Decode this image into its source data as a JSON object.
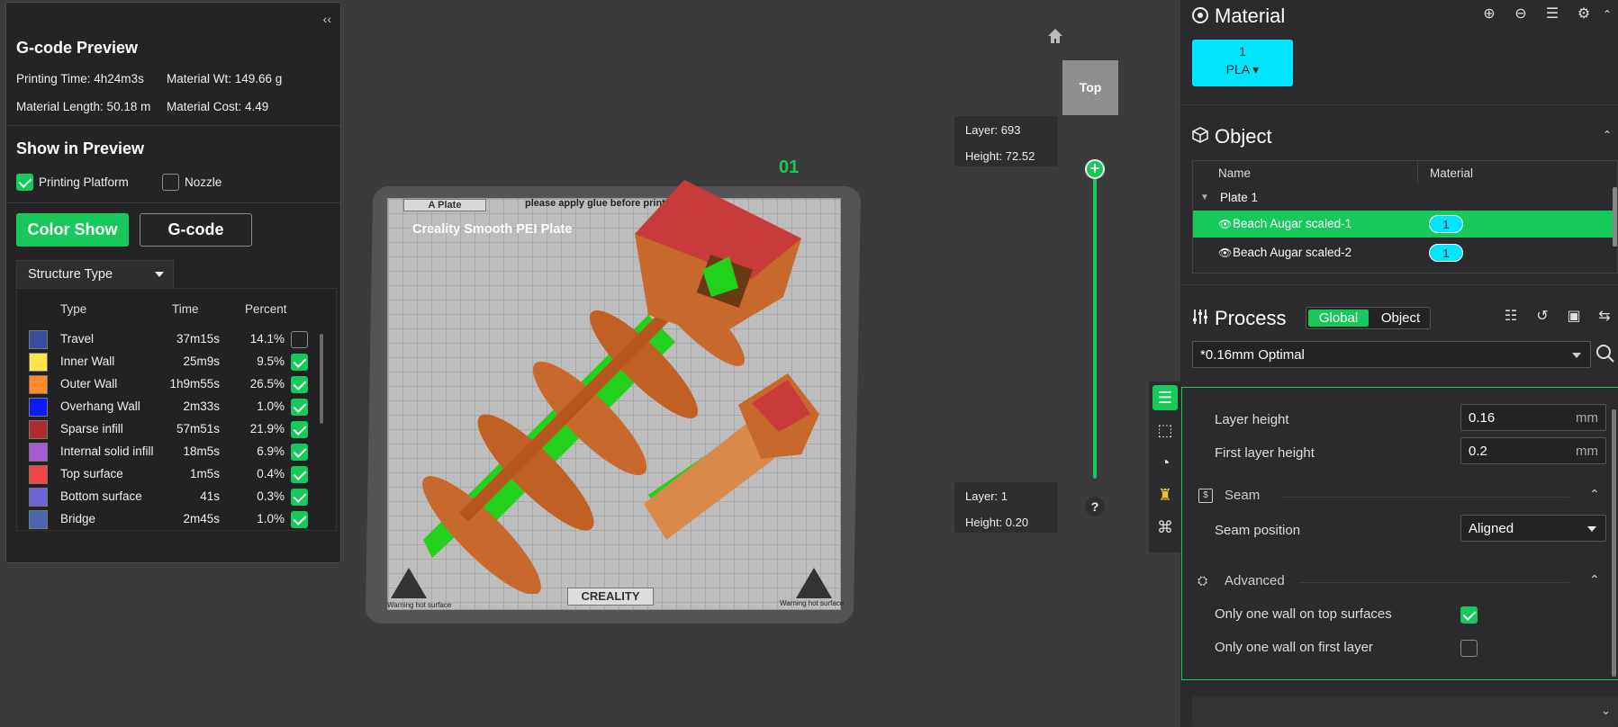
{
  "gcode_panel": {
    "collapse_icon": "double-chevron-left",
    "title": "G-code Preview",
    "printing_time": "Printing Time: 4h24m3s",
    "material_wt": "Material Wt: 149.66 g",
    "material_length": "Material Length: 50.18 m",
    "material_cost": "Material Cost: 4.49",
    "show_in_preview": "Show in Preview",
    "printing_platform": "Printing Platform",
    "nozzle": "Nozzle",
    "color_show": "Color Show",
    "gcode": "G-code",
    "structure_type": "Structure Type",
    "headers": {
      "type": "Type",
      "time": "Time",
      "percent": "Percent"
    },
    "rows": [
      {
        "name": "Travel",
        "time": "37m15s",
        "percent": "14.1%",
        "color": "#3a4f9c",
        "checked": false
      },
      {
        "name": "Inner Wall",
        "time": "25m9s",
        "percent": "9.5%",
        "color": "#ffe24d",
        "checked": true
      },
      {
        "name": "Outer Wall",
        "time": "1h9m55s",
        "percent": "26.5%",
        "color": "#ff8a2b",
        "checked": true
      },
      {
        "name": "Overhang Wall",
        "time": "2m33s",
        "percent": "1.0%",
        "color": "#0a1aff",
        "checked": true
      },
      {
        "name": "Sparse infill",
        "time": "57m51s",
        "percent": "21.9%",
        "color": "#b02b2b",
        "checked": true
      },
      {
        "name": "Internal solid infill",
        "time": "18m5s",
        "percent": "6.9%",
        "color": "#a55bd6",
        "checked": true
      },
      {
        "name": "Top surface",
        "time": "1m5s",
        "percent": "0.4%",
        "color": "#f04848",
        "checked": true
      },
      {
        "name": "Bottom surface",
        "time": "41s",
        "percent": "0.3%",
        "color": "#6b63d6",
        "checked": true
      },
      {
        "name": "Bridge",
        "time": "2m45s",
        "percent": "1.0%",
        "color": "#4a66b0",
        "checked": true
      }
    ]
  },
  "viewport": {
    "plate_tab": "A Plate",
    "plate_note": "please apply glue before printing",
    "plate_name": "Creality Smooth PEI Plate",
    "plate_number": "01",
    "plate_logo": "CREALITY",
    "warning_text": "Warning hot surface",
    "view_cube": "Top",
    "layer_top": {
      "layer": "Layer: 693",
      "height": "Height: 72.52"
    },
    "layer_bottom": {
      "layer": "Layer: 1",
      "height": "Height: 0.20"
    },
    "help": "?",
    "slider_plus": "+"
  },
  "material": {
    "title": "Material",
    "chip_number": "1",
    "chip_label": "PLA",
    "chip_color": "#00e5ff"
  },
  "object": {
    "title": "Object",
    "col_name": "Name",
    "col_material": "Material",
    "plate": "Plate 1",
    "items": [
      {
        "name": "Beach Augar scaled-1",
        "material": "1"
      },
      {
        "name": "Beach Augar scaled-2",
        "material": "1"
      }
    ]
  },
  "process": {
    "title": "Process",
    "tab_global": "Global",
    "tab_object": "Object",
    "preset": "*0.16mm Optimal",
    "layer_height_label": "Layer height",
    "layer_height_value": "0.16",
    "first_layer_height_label": "First layer height",
    "first_layer_height_value": "0.2",
    "unit": "mm",
    "seam_group": "Seam",
    "seam_position_label": "Seam position",
    "seam_position_value": "Aligned",
    "advanced_group": "Advanced",
    "one_wall_top_label": "Only one wall on top surfaces",
    "one_wall_top_checked": true,
    "one_wall_first_label": "Only one wall on first layer",
    "one_wall_first_checked": false
  },
  "colors": {
    "accent": "#17c95a",
    "cyan": "#00e5ff",
    "panel": "#242426"
  }
}
